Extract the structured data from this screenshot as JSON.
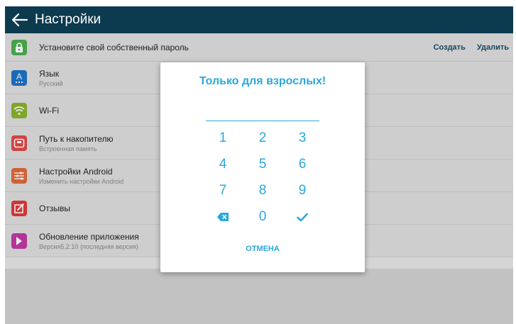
{
  "topbar": {
    "title": "Настройки",
    "back_icon": "arrow-left-icon"
  },
  "settings": {
    "password": {
      "title": "Установите свой собственный пароль",
      "create": "Создать",
      "delete": "Удалить",
      "icon": "lock-icon"
    },
    "items": [
      {
        "title": "Язык",
        "subtitle": "Русский",
        "icon": "language-icon",
        "color": "#1e73c8"
      },
      {
        "title": "Wi-Fi",
        "subtitle": "",
        "icon": "wifi-icon",
        "color": "#8ab52e"
      },
      {
        "title": "Путь к накопителю",
        "subtitle": "Встроенная память",
        "icon": "storage-icon",
        "color": "#e24a4a"
      },
      {
        "title": "Настройки Android",
        "subtitle": "Изменить настройки Android",
        "icon": "sliders-icon",
        "color": "#e26a3a"
      },
      {
        "title": "Отзывы",
        "subtitle": "",
        "icon": "edit-icon",
        "color": "#e23a3a"
      },
      {
        "title": "Обновление приложения",
        "subtitle": "Версия5.2.10 (последняя версия)",
        "icon": "update-icon",
        "color": "#c23aa8"
      }
    ]
  },
  "dialog": {
    "title": "Только для взрослых!",
    "keys": [
      "1",
      "2",
      "3",
      "4",
      "5",
      "6",
      "7",
      "8",
      "9",
      "0"
    ],
    "cancel": "ОТМЕНА",
    "accent": "#2aa8dc"
  }
}
